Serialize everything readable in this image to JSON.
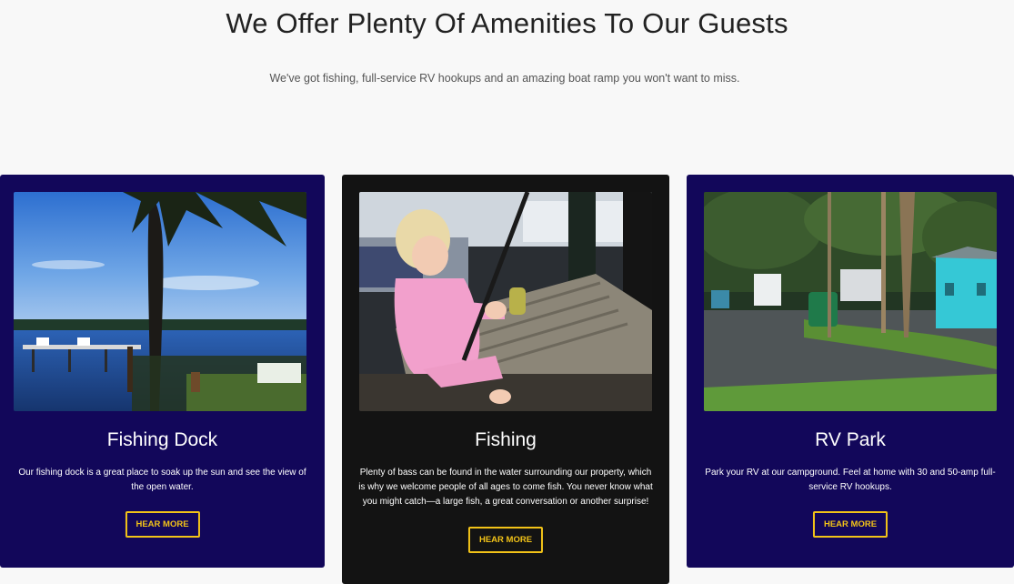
{
  "header": {
    "title": "We Offer Plenty Of Amenities To Our Guests",
    "subtitle": "We've got fishing, full-service RV hookups and an amazing boat ramp you won't want to miss."
  },
  "cards": [
    {
      "title": "Fishing Dock",
      "text": "Our fishing dock is a great place to soak up the sun and see the view of the open water.",
      "button": "HEAR MORE",
      "image": "lake-dock-photo",
      "color": "#12075a"
    },
    {
      "title": "Fishing",
      "text": "Plenty of bass can be found in the water surrounding our property, which is why we welcome people of all ages to come fish. You never know what you might catch—a large fish, a great conversation or another surprise!",
      "button": "HEAR MORE",
      "image": "child-fishing-photo",
      "color": "#131313"
    },
    {
      "title": "RV Park",
      "text": "Park your RV at our campground. Feel at home with 30 and 50-amp full-service RV hookups.",
      "button": "HEAR MORE",
      "image": "rv-campground-photo",
      "color": "#12075a"
    }
  ],
  "colors": {
    "accent": "#f2c318",
    "navy": "#12075a",
    "dark": "#131313"
  }
}
